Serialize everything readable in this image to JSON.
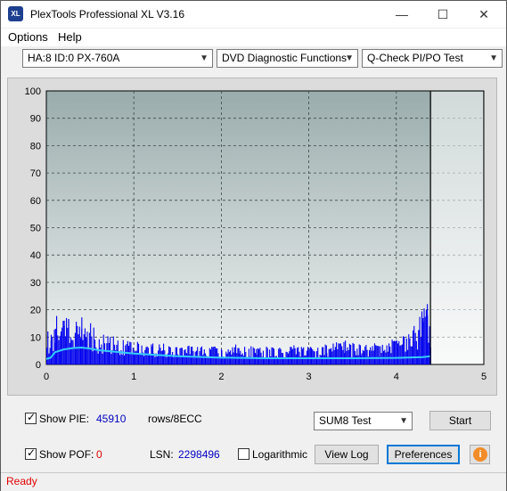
{
  "window": {
    "title": "PlexTools Professional XL V3.16",
    "icon_text": "XL",
    "buttons": {
      "minimize": "—",
      "maximize": "☐",
      "close": "✕"
    }
  },
  "menu": [
    {
      "label": "Options"
    },
    {
      "label": "Help"
    }
  ],
  "toolbar": {
    "drive": "HA:8 ID:0  PX-760A",
    "function": "DVD Diagnostic Functions",
    "test": "Q-Check PI/PO Test"
  },
  "chart_data": {
    "type": "area",
    "x_ticks": [
      "0",
      "1",
      "2",
      "3",
      "4",
      "5"
    ],
    "y_ticks": [
      "0",
      "10",
      "20",
      "30",
      "40",
      "50",
      "60",
      "70",
      "80",
      "90",
      "100"
    ],
    "xlim": [
      0,
      5
    ],
    "ylim": [
      0,
      100
    ],
    "grid": true,
    "colors": {
      "bars": "#0000ee",
      "avg_line": "#33ccff",
      "plot_bg_top": "#9aacac",
      "plot_bg_bottom": "#f2f4f4",
      "end_marker": "#000000"
    },
    "end_marker_x": 4.39,
    "series": [
      {
        "x": [
          0.0,
          0.05,
          0.1,
          0.15,
          0.2,
          0.25,
          0.3,
          0.35,
          0.4,
          0.45,
          0.5,
          0.55,
          0.6,
          0.7,
          0.8,
          0.9,
          1.0,
          1.2,
          1.4,
          1.6,
          1.8,
          2.0,
          2.2,
          2.4,
          2.6,
          2.8,
          3.0,
          3.2,
          3.4,
          3.6,
          3.8,
          4.0,
          4.1,
          4.2,
          4.25,
          4.3,
          4.35,
          4.39
        ],
        "values": [
          12,
          10,
          17,
          16,
          15,
          16,
          14,
          15,
          17,
          15,
          14,
          12,
          11,
          10,
          9,
          8,
          8,
          7,
          7,
          7,
          6,
          6,
          7,
          6,
          6,
          7,
          6,
          7,
          8,
          7,
          8,
          9,
          11,
          14,
          16,
          21,
          25,
          15
        ]
      },
      {
        "x": [
          0.0,
          0.05,
          0.1,
          0.2,
          0.3,
          0.4,
          0.5,
          0.6,
          0.8,
          1.0,
          1.5,
          2.0,
          2.5,
          3.0,
          3.5,
          4.0,
          4.3,
          4.39
        ],
        "values": [
          2,
          2.5,
          4.5,
          5.5,
          6,
          6.2,
          5.8,
          5.2,
          4.6,
          4.0,
          3.0,
          2.5,
          2.3,
          2.3,
          2.3,
          2.4,
          2.7,
          3.0
        ]
      }
    ]
  },
  "controls": {
    "show_pie_label": "Show PIE:",
    "show_pie_checked": true,
    "pie_value": "45910",
    "rows_label": "rows/8ECC",
    "show_pof_label": "Show POF:",
    "show_pof_checked": true,
    "pof_value": "0",
    "lsn_label": "LSN:",
    "lsn_value": "2298496",
    "logarithmic_label": "Logarithmic",
    "logarithmic_checked": false,
    "sum_select": "SUM8 Test",
    "start_button": "Start",
    "viewlog_button": "View Log",
    "preferences_button": "Preferences",
    "info_button": "i"
  },
  "status": {
    "text": "Ready"
  }
}
